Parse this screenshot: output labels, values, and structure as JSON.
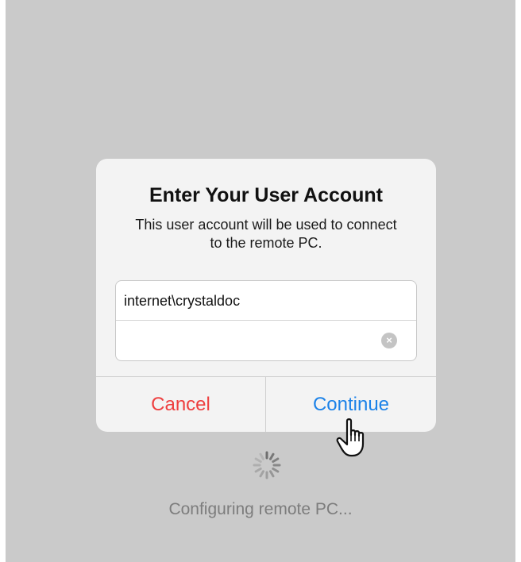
{
  "dialog": {
    "title": "Enter Your User Account",
    "message": "This user account will be used to connect to the remote PC.",
    "username_value": "internet\\crystaldoc",
    "password_value": "",
    "clear_icon": "×",
    "cancel_label": "Cancel",
    "continue_label": "Continue"
  },
  "status": {
    "text": "Configuring remote PC..."
  },
  "colors": {
    "background": "#cacaca",
    "dialog": "#f3f3f3",
    "cancel": "#ee3f3f",
    "continue": "#1c82e8",
    "status_text": "#7d7d7d"
  }
}
